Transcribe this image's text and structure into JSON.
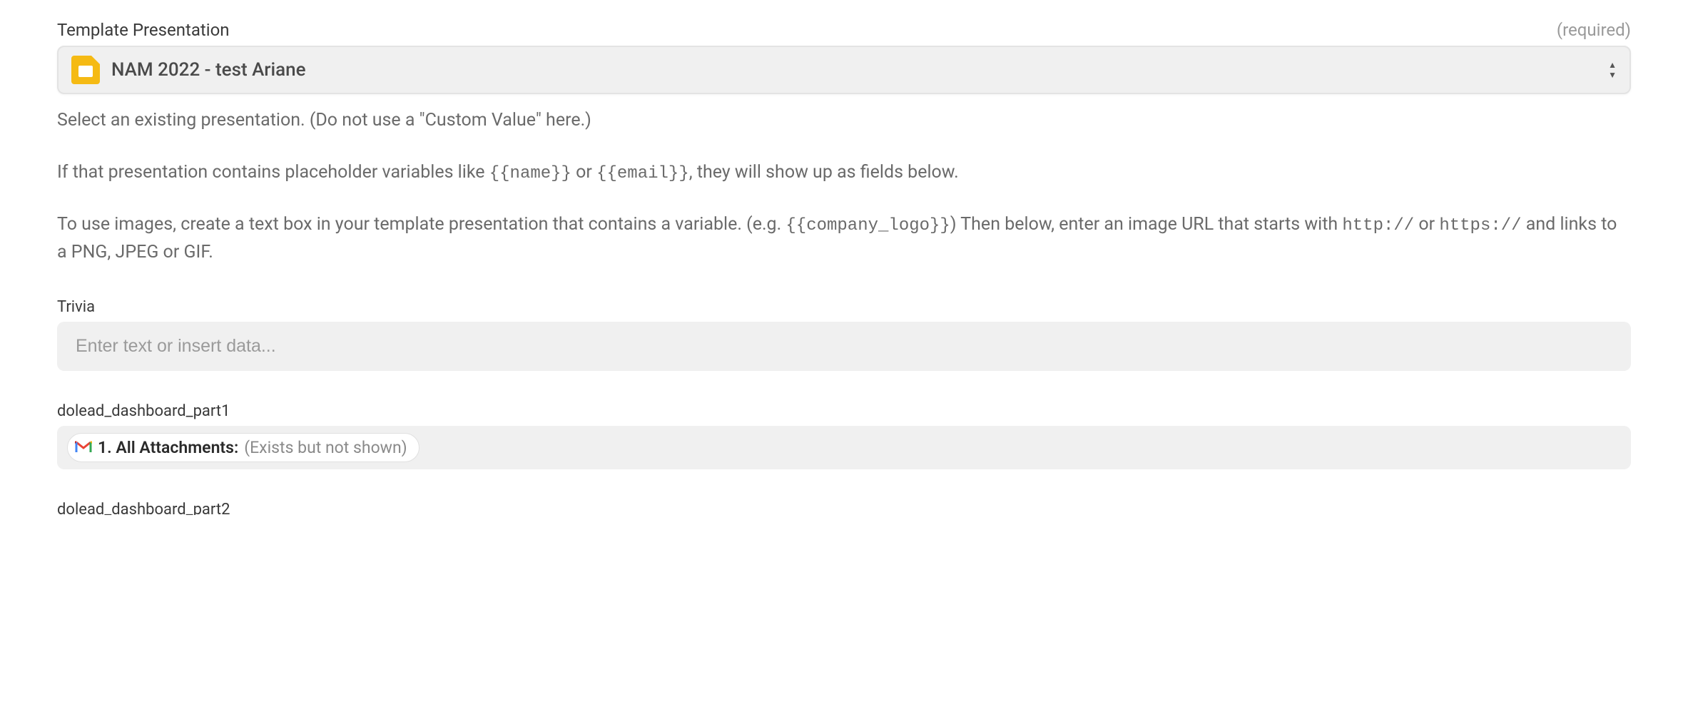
{
  "template_presentation": {
    "label": "Template Presentation",
    "required_text": "(required)",
    "selected_value": "NAM 2022 - test Ariane",
    "help_line1": "Select an existing presentation. (Do not use a \"Custom Value\" here.)",
    "help_line2_pre": "If that presentation contains placeholder variables like ",
    "help_line2_var1": "{{name}}",
    "help_line2_mid": " or ",
    "help_line2_var2": "{{email}}",
    "help_line2_post": ", they will show up as fields below.",
    "help_line3_pre": "To use images, create a text box in your template presentation that contains a variable. (e.g. ",
    "help_line3_var": "{{company_logo}}",
    "help_line3_mid": ") Then below, enter an image URL that starts with ",
    "help_line3_http": "http://",
    "help_line3_or": " or ",
    "help_line3_https": "https://",
    "help_line3_post": " and links to a PNG, JPEG or GIF."
  },
  "trivia": {
    "label": "Trivia",
    "placeholder": "Enter text or insert data..."
  },
  "dashboard1": {
    "label": "dolead_dashboard_part1",
    "pill_bold": "1. All Attachments: ",
    "pill_muted": "(Exists but not shown)"
  },
  "dashboard2": {
    "label": "dolead_dashboard_part2"
  }
}
